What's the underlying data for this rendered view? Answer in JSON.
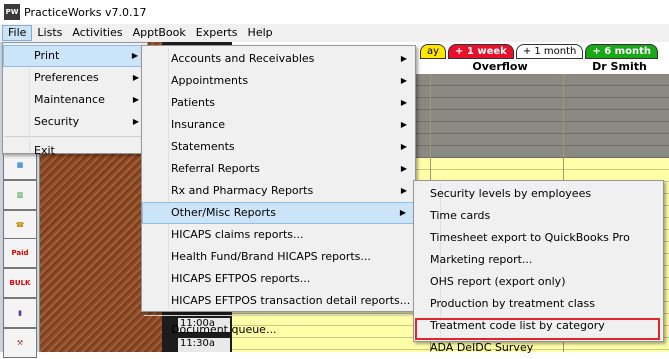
{
  "window": {
    "title": "PracticeWorks v7.0.17",
    "icon_text": "PW"
  },
  "menubar": [
    "File",
    "Lists",
    "Activities",
    "ApptBook",
    "Experts",
    "Help"
  ],
  "background": {
    "tabs": [
      "ay",
      "+ 1 week",
      "+ 1 month",
      "+ 6 month"
    ],
    "columns": [
      "Overflow",
      "Dr Smith"
    ],
    "times": [
      "11:00a",
      "11:30a"
    ],
    "toolbar_labels": [
      "Paid",
      "BULK"
    ]
  },
  "file_menu": {
    "items": [
      {
        "label": "Print",
        "submenu": true
      },
      {
        "label": "Preferences",
        "submenu": true
      },
      {
        "label": "Maintenance",
        "submenu": true
      },
      {
        "label": "Security",
        "submenu": true
      },
      {
        "label": "Exit",
        "submenu": false
      }
    ]
  },
  "print_menu": {
    "items": [
      {
        "label": "Accounts and Receivables",
        "submenu": true
      },
      {
        "label": "Appointments",
        "submenu": true
      },
      {
        "label": "Patients",
        "submenu": true
      },
      {
        "label": "Insurance",
        "submenu": true
      },
      {
        "label": "Statements",
        "submenu": true
      },
      {
        "label": "Referral Reports",
        "submenu": true
      },
      {
        "label": "Rx and Pharmacy Reports",
        "submenu": true
      },
      {
        "label": "Other/Misc Reports",
        "submenu": true
      },
      {
        "label": "HICAPS claims reports...",
        "submenu": false
      },
      {
        "label": "Health Fund/Brand HICAPS reports...",
        "submenu": false
      },
      {
        "label": "HICAPS EFTPOS reports...",
        "submenu": false
      },
      {
        "label": "HICAPS EFTPOS transaction detail reports...",
        "submenu": false
      },
      {
        "label": "Document queue...",
        "submenu": false
      }
    ]
  },
  "other_menu": {
    "items": [
      "Security levels by employees",
      "Time cards",
      "Timesheet export to QuickBooks Pro",
      "Marketing report...",
      "OHS report (export only)",
      "Production by treatment class",
      "Treatment code list by category",
      "ADA DeIDC Survey"
    ]
  },
  "colors": {
    "highlight": "#cce4f7",
    "red_box": "#e0262a",
    "schedule_yellow": "#ffffa8"
  }
}
